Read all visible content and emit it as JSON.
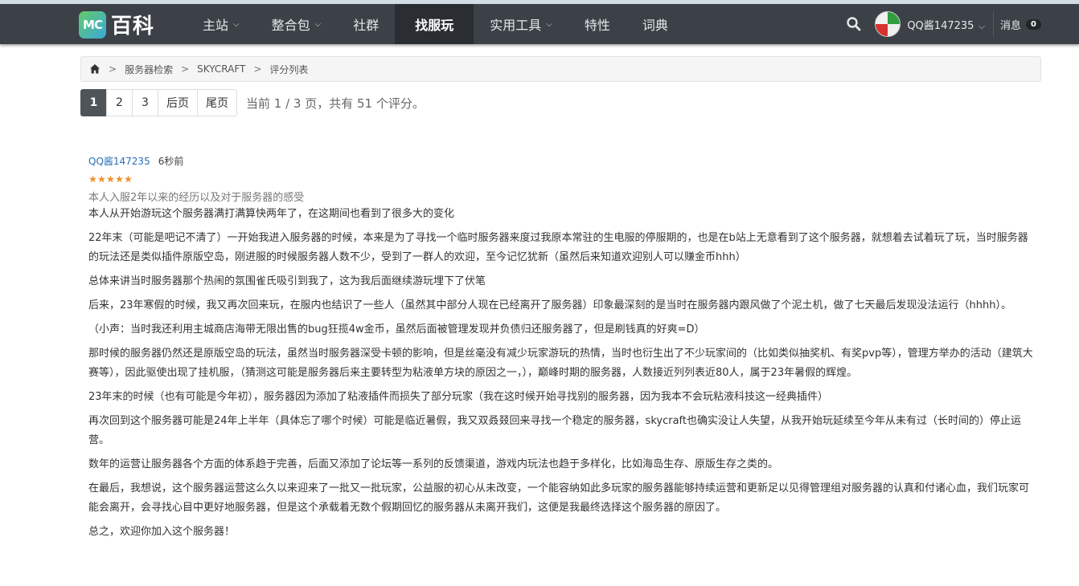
{
  "brand": {
    "badge": "MC",
    "name": "百科"
  },
  "nav": [
    {
      "label": "主站",
      "dropdown": true,
      "active": false
    },
    {
      "label": "整合包",
      "dropdown": true,
      "active": false
    },
    {
      "label": "社群",
      "dropdown": false,
      "active": false
    },
    {
      "label": "找服玩",
      "dropdown": false,
      "active": true
    },
    {
      "label": "实用工具",
      "dropdown": true,
      "active": false
    },
    {
      "label": "特性",
      "dropdown": false,
      "active": false
    },
    {
      "label": "词典",
      "dropdown": false,
      "active": false
    }
  ],
  "user": {
    "name": "QQ酱147235",
    "messages_label": "消息",
    "messages_count": "0"
  },
  "breadcrumb": [
    "服务器检索",
    "SKYCRAFT",
    "评分列表"
  ],
  "pagination": {
    "pages": [
      "1",
      "2",
      "3"
    ],
    "current": "1",
    "next_label": "后页",
    "last_label": "尾页",
    "info": "当前 1 / 3 页，共有 51 个评分。"
  },
  "review": {
    "author": "QQ酱147235",
    "time": "6秒前",
    "rating": 5,
    "title": "本人入服2年以来的经历以及对于服务器的感受",
    "paragraphs": [
      "本人从开始游玩这个服务器满打满算快两年了，在这期间也看到了很多大的变化",
      "22年末（可能是吧记不清了）一开始我进入服务器的时候，本来是为了寻找一个临时服务器来度过我原本常驻的生电服的停服期的，也是在b站上无意看到了这个服务器，就想着去试着玩了玩，当时服务器的玩法还是类似插件原版空岛，刚进服的时候服务器人数不少，受到了一群人的欢迎，至今记忆犹新（虽然后来知道欢迎别人可以赚金币hhh）",
      "总体来讲当时服务器那个热闹的氛围雀氏吸引到我了，这为我后面继续游玩埋下了伏笔",
      "后来，23年寒假的时候，我又再次回来玩，在服内也结识了一些人（虽然其中部分人现在已经离开了服务器）印象最深刻的是当时在服务器内跟风做了个泥土机，做了七天最后发现没法运行（hhhh）。",
      "（小声：当时我还利用主城商店海带无限出售的bug狂揽4w金币，虽然后面被管理发现并负债归还服务器了，但是刷钱真的好爽=D）",
      "那时候的服务器仍然还是原版空岛的玩法，虽然当时服务器深受卡顿的影响，但是丝毫没有减少玩家游玩的热情，当时也衍生出了不少玩家间的（比如类似抽奖机、有奖pvp等），管理方举办的活动（建筑大赛等），因此驱使出现了挂机服，（猜测这可能是服务器后来主要转型为粘液单方块的原因之一，），巅峰时期的服务器，人数接近列列表近80人，属于23年暑假的辉煌。",
      "23年末的时候（也有可能是今年初），服务器因为添加了粘液插件而损失了部分玩家（我在这时候开始寻找别的服务器，因为我本不会玩粘液科技这一经典插件）",
      "再次回到这个服务器可能是24年上半年（具体忘了哪个时候）可能是临近暑假，我又双叒叕回来寻找一个稳定的服务器，skycraft也确实没让人失望，从我开始玩延续至今年从未有过（长时间的）停止运营。",
      "数年的运营让服务器各个方面的体系趋于完善，后面又添加了论坛等一系列的反馈渠道，游戏内玩法也趋于多样化，比如海岛生存、原版生存之类的。",
      "在最后，我想说，这个服务器运营这么久以来迎来了一批又一批玩家，公益服的初心从未改变，一个能容纳如此多玩家的服务器能够持续运营和更新足以见得管理组对服务器的认真和付诸心血，我们玩家可能会离开，会寻找心目中更好地服务器，但是这个承载着无数个假期回忆的服务器从未离开我们，这便是我最终选择这个服务器的原因了。",
      "总之，欢迎你加入这个服务器！"
    ]
  },
  "colors": {
    "navbar": "#3c4147",
    "active_nav": "#2a2e33",
    "link": "#2a6eb5",
    "star": "#f0932b"
  }
}
